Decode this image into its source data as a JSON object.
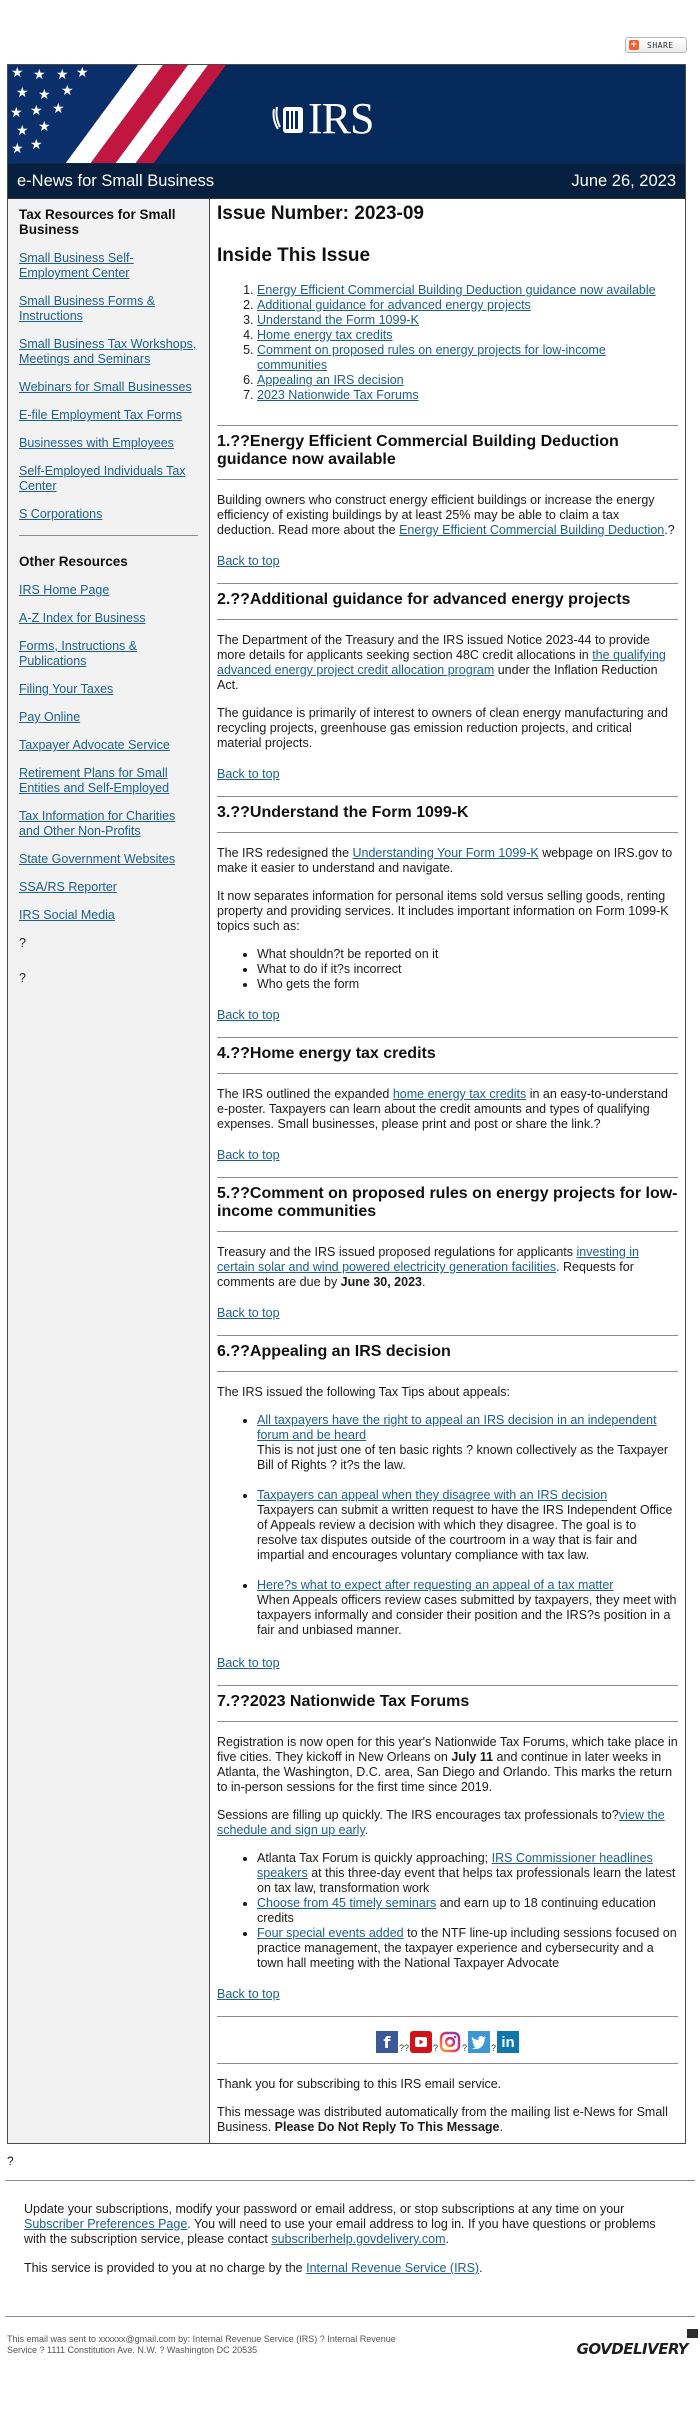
{
  "share": {
    "label": "SHARE"
  },
  "header": {
    "logo_text": "IRS",
    "newsletter_title": "e-News for Small Business",
    "date": "June 26, 2023",
    "colors": {
      "navy": "#05295b",
      "dark_bar": "#061f3e",
      "red_stripe": "#c0163f"
    }
  },
  "sidebar": {
    "section1_title": "Tax Resources for Small Business",
    "section1_links": [
      "Small Business Self-Employment Center",
      "Small Business Forms & Instructions",
      "Small Business Tax Workshops, Meetings and Seminars",
      "Webinars for Small Businesses",
      "E-file Employment Tax Forms",
      "Businesses with Employees",
      "Self-Employed Individuals Tax Center",
      "S Corporations"
    ],
    "section2_title": "Other Resources",
    "section2_links": [
      "IRS Home Page",
      "A-Z Index for Business",
      "Forms, Instructions & Publications",
      "Filing Your Taxes",
      "Pay Online",
      "Taxpayer Advocate Service",
      "Retirement Plans for Small Entities and Self-Employed",
      "Tax Information for Charities and Other Non-Profits",
      "State Government Websites",
      "SSA/RS Reporter",
      "IRS Social Media"
    ],
    "trailing_marks": [
      "?",
      "?"
    ]
  },
  "main": {
    "issue_number": "Issue Number: 2023-09",
    "inside_title": "Inside This Issue",
    "toc": [
      "Energy Efficient Commercial Building Deduction guidance now available",
      "Additional guidance for advanced energy projects",
      "Understand the Form 1099-K",
      "Home energy tax credits",
      "Comment on proposed rules on energy projects for low-income communities",
      "Appealing an IRS decision",
      "2023 Nationwide Tax Forums"
    ],
    "back_to_top": "Back to top",
    "sections": [
      {
        "title": "1.??Energy Efficient Commercial Building Deduction guidance now available",
        "p1_before": "Building owners who construct energy efficient buildings or increase the energy efficiency of existing buildings by at least 25% may be able to claim a tax deduction. Read more about the ",
        "p1_link": "Energy Efficient Commercial Building Deduction",
        "p1_after": ".?"
      },
      {
        "title": "2.??Additional guidance for advanced energy projects",
        "p1_before": "The Department of the Treasury and the IRS issued Notice 2023-44 to provide more details for applicants seeking section 48C credit allocations in ",
        "p1_link": "the qualifying advanced energy project credit allocation program",
        "p1_after": " under the Inflation Reduction Act.",
        "p2": "The guidance is primarily of interest to owners of clean energy manufacturing and recycling projects, greenhouse gas emission reduction projects, and critical material projects."
      },
      {
        "title": "3.??Understand the Form 1099-K",
        "p1_before": "The IRS redesigned the ",
        "p1_link": "Understanding Your Form 1099-K",
        "p1_after": " webpage on IRS.gov to make it easier to understand and navigate.",
        "p2": "It now separates information for personal items sold versus selling goods, renting property and providing services. It includes important information on Form 1099-K topics such as:",
        "bullets": [
          "What shouldn?t be reported on it",
          "What to do if it?s incorrect",
          "Who gets the form"
        ]
      },
      {
        "title": "4.??Home energy tax credits",
        "p1_before": "The IRS outlined the expanded ",
        "p1_link": "home energy tax credits",
        "p1_after": " in an easy-to-understand e-poster. Taxpayers can learn about the credit amounts and types of qualifying expenses. Small businesses, please print and post or share the link.?"
      },
      {
        "title": "5.??Comment on proposed rules on energy projects for low-income communities",
        "p1_before": "Treasury and the IRS issued proposed regulations for applicants ",
        "p1_link": "investing in certain solar and wind powered electricity generation facilities",
        "p1_mid": ". Requests for comments are due by ",
        "p1_bold": "June 30, 2023",
        "p1_after": "."
      },
      {
        "title": "6.??Appealing an IRS decision",
        "p1": "The IRS issued the following Tax Tips about appeals:",
        "tips": [
          {
            "link": "All taxpayers have the right to appeal an IRS decision in an independent forum and be heard",
            "text": "This is not just one of ten basic rights ? known collectively as the Taxpayer Bill of Rights ? it?s the law."
          },
          {
            "link": "Taxpayers can appeal when they disagree with an IRS decision",
            "text": "Taxpayers can submit a written request to have the IRS Independent Office of Appeals review a decision with which they disagree. The goal is to resolve tax disputes outside of the courtroom in a way that is fair and impartial and encourages voluntary compliance with tax law."
          },
          {
            "link": "Here?s what to expect after requesting an appeal of a tax matter",
            "text": "When Appeals officers review cases submitted by taxpayers, they meet with taxpayers informally and consider their position and the IRS?s position in a fair and unbiased manner."
          }
        ]
      },
      {
        "title": "7.??2023 Nationwide Tax Forums",
        "p1_before": "Registration is now open for this year's Nationwide Tax Forums, which take place in five cities. They kickoff in New Orleans on ",
        "p1_bold": "July 11",
        "p1_after": " and continue in later weeks in Atlanta, the Washington, D.C. area, San Diego and Orlando. This marks the return to in-person sessions for the first time since 2019.",
        "p2_before": "Sessions are filling up quickly. The IRS encourages tax professionals to?",
        "p2_link": "view the schedule and sign up early",
        "p2_after": ".",
        "bullets": [
          {
            "before": "Atlanta Tax Forum is quickly approaching; ",
            "link": "IRS Commissioner headlines speakers",
            "after": " at this three-day event that helps tax professionals learn the latest on tax law, transformation work"
          },
          {
            "before": "",
            "link": "Choose from 45 timely seminars",
            "after": " and earn up to 18 continuing education credits"
          },
          {
            "before": "",
            "link": "Four special events added",
            "after": " to the NTF line-up including sessions focused on practice management, the taxpayer experience and cybersecurity and a town hall meeting with the National Taxpayer Advocate"
          }
        ]
      }
    ],
    "social": {
      "icons": [
        "facebook-icon",
        "youtube-icon",
        "instagram-icon",
        "twitter-icon",
        "linkedin-icon"
      ],
      "separators": [
        "??",
        "?",
        "?",
        "?"
      ]
    },
    "thanks": "Thank you for subscribing to this IRS email service.",
    "distributed_before": "This message was distributed automatically from the mailing list e-News for Small Business. ",
    "distributed_bold": "Please Do Not Reply To This Message",
    "distributed_after": "."
  },
  "footer": {
    "question_mark": "?",
    "update_before": "Update your subscriptions, modify your password or email address, or stop subscriptions at any time on your ",
    "update_link": "Subscriber Preferences Page",
    "update_mid": ". You will need to use your email address to log in. If you have questions or problems with the subscription service, please contact ",
    "help_link": "subscriberhelp.govdelivery.com",
    "update_after": ".",
    "service_before": "This service is provided to you at no charge by the ",
    "service_link": "Internal Revenue Service (IRS)",
    "service_after": ".",
    "small_print": "This email was sent to xxxxxx@gmail.com by: Internal Revenue Service (IRS) ? Internal Revenue Service ? 1111 Constitution Ave. N.W. ? Washington DC 20535",
    "brand": "GOVDELIVERY"
  }
}
